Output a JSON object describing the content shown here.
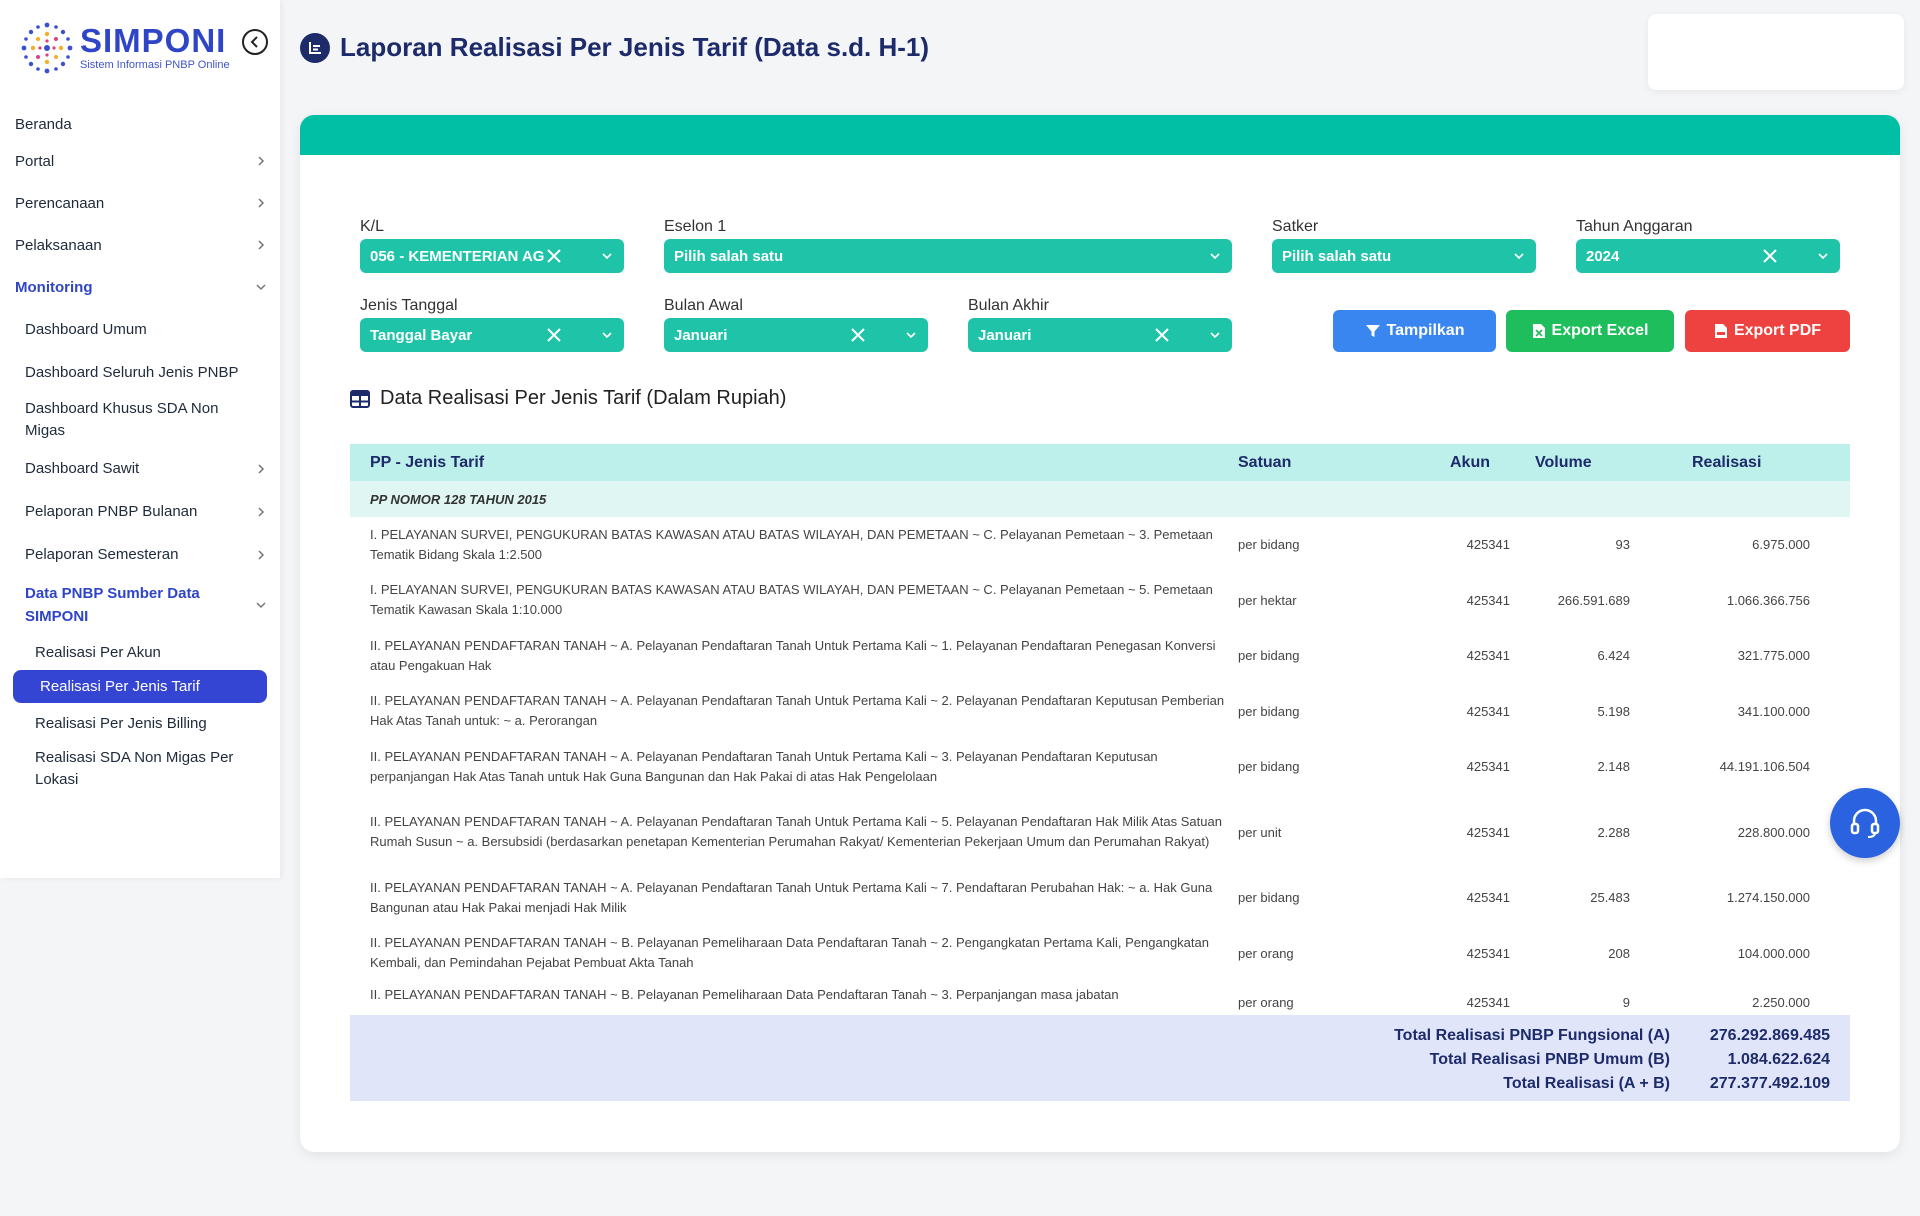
{
  "app": {
    "title": "SIMPONI",
    "subtitle": "Sistem Informasi PNBP Online"
  },
  "sidebar": {
    "items": [
      {
        "label": "Beranda"
      },
      {
        "label": "Portal"
      },
      {
        "label": "Perencanaan"
      },
      {
        "label": "Pelaksanaan"
      },
      {
        "label": "Monitoring"
      },
      {
        "label": "Dashboard Umum"
      },
      {
        "label": "Dashboard Seluruh Jenis PNBP"
      },
      {
        "label": "Dashboard Khusus SDA Non Migas"
      },
      {
        "label": "Dashboard Sawit"
      },
      {
        "label": "Pelaporan PNBP Bulanan"
      },
      {
        "label": "Pelaporan Semesteran"
      },
      {
        "label": "Data PNBP Sumber Data SIMPONI"
      },
      {
        "label": "Realisasi Per Akun"
      },
      {
        "label": "Realisasi Per Jenis Tarif"
      },
      {
        "label": "Realisasi Per Jenis Billing"
      },
      {
        "label": "Realisasi SDA Non Migas Per Lokasi"
      }
    ]
  },
  "header": {
    "title": "Laporan Realisasi Per Jenis Tarif (Data s.d. H-1)"
  },
  "filters": {
    "kl": {
      "label": "K/L",
      "value": "056 - KEMENTERIAN AG"
    },
    "eselon": {
      "label": "Eselon 1",
      "value": "Pilih salah satu"
    },
    "satker": {
      "label": "Satker",
      "value": "Pilih salah satu"
    },
    "tahun": {
      "label": "Tahun Anggaran",
      "value": "2024"
    },
    "jenis_tanggal": {
      "label": "Jenis Tanggal",
      "value": "Tanggal Bayar"
    },
    "bulan_awal": {
      "label": "Bulan Awal",
      "value": "Januari"
    },
    "bulan_akhir": {
      "label": "Bulan Akhir",
      "value": "Januari"
    }
  },
  "buttons": {
    "show": "Tampilkan",
    "excel": "Export Excel",
    "pdf": "Export PDF"
  },
  "colors": {
    "teal": "#00bfa5",
    "navy": "#1d2b6b",
    "blue": "#3a86f0",
    "green": "#1fbe5c",
    "red": "#ee4240"
  },
  "section": {
    "title": "Data Realisasi Per Jenis Tarif (Dalam Rupiah)"
  },
  "table": {
    "headers": {
      "jenis": "PP - Jenis Tarif",
      "satuan": "Satuan",
      "akun": "Akun",
      "volume": "Volume",
      "realisasi": "Realisasi"
    },
    "group": "PP NOMOR 128 TAHUN 2015",
    "rows": [
      {
        "jenis": "I. PELAYANAN SURVEI, PENGUKURAN BATAS KAWASAN ATAU BATAS WILAYAH, DAN PEMETAAN ~ C. Pelayanan Pemetaan ~ 3. Pemetaan Tematik Bidang Skala 1:2.500",
        "satuan": "per bidang",
        "akun": "425341",
        "volume": "93",
        "realisasi": "6.975.000"
      },
      {
        "jenis": "I. PELAYANAN SURVEI, PENGUKURAN BATAS KAWASAN ATAU BATAS WILAYAH, DAN PEMETAAN ~ C. Pelayanan Pemetaan ~ 5. Pemetaan Tematik Kawasan Skala 1:10.000",
        "satuan": "per hektar",
        "akun": "425341",
        "volume": "266.591.689",
        "realisasi": "1.066.366.756"
      },
      {
        "jenis": "II. PELAYANAN PENDAFTARAN TANAH ~ A. Pelayanan Pendaftaran Tanah Untuk Pertama Kali ~ 1. Pelayanan Pendaftaran Penegasan Konversi atau Pengakuan Hak",
        "satuan": "per bidang",
        "akun": "425341",
        "volume": "6.424",
        "realisasi": "321.775.000"
      },
      {
        "jenis": "II. PELAYANAN PENDAFTARAN TANAH ~ A. Pelayanan Pendaftaran Tanah Untuk Pertama Kali ~ 2. Pelayanan Pendaftaran Keputusan Pemberian Hak Atas Tanah untuk: ~ a. Perorangan",
        "satuan": "per bidang",
        "akun": "425341",
        "volume": "5.198",
        "realisasi": "341.100.000"
      },
      {
        "jenis": "II. PELAYANAN PENDAFTARAN TANAH ~ A. Pelayanan Pendaftaran Tanah Untuk Pertama Kali ~ 3. Pelayanan Pendaftaran Keputusan perpanjangan Hak Atas Tanah untuk Hak Guna Bangunan dan Hak Pakai di atas Hak Pengelolaan",
        "satuan": "per bidang",
        "akun": "425341",
        "volume": "2.148",
        "realisasi": "44.191.106.504"
      },
      {
        "jenis": "II. PELAYANAN PENDAFTARAN TANAH ~ A. Pelayanan Pendaftaran Tanah Untuk Pertama Kali ~ 5. Pelayanan Pendaftaran Hak Milik Atas Satuan Rumah Susun ~ a. Bersubsidi (berdasarkan penetapan Kementerian Perumahan Rakyat/ Kementerian Pekerjaan Umum dan Perumahan Rakyat)",
        "satuan": "per unit",
        "akun": "425341",
        "volume": "2.288",
        "realisasi": "228.800.000"
      },
      {
        "jenis": "II. PELAYANAN PENDAFTARAN TANAH ~ A. Pelayanan Pendaftaran Tanah Untuk Pertama Kali ~ 7. Pendaftaran Perubahan Hak: ~ a. Hak Guna Bangunan atau Hak Pakai menjadi Hak Milik",
        "satuan": "per bidang",
        "akun": "425341",
        "volume": "25.483",
        "realisasi": "1.274.150.000"
      },
      {
        "jenis": "II. PELAYANAN PENDAFTARAN TANAH ~ B. Pelayanan Pemeliharaan Data Pendaftaran Tanah ~ 2. Pengangkatan Pertama Kali, Pengangkatan Kembali, dan Pemindahan Pejabat Pembuat Akta Tanah",
        "satuan": "per orang",
        "akun": "425341",
        "volume": "208",
        "realisasi": "104.000.000"
      },
      {
        "jenis": "II. PELAYANAN PENDAFTARAN TANAH ~ B. Pelayanan Pemeliharaan Data Pendaftaran Tanah ~ 3. Perpanjangan masa jabatan",
        "satuan": "per orang",
        "akun": "425341",
        "volume": "9",
        "realisasi": "2.250.000"
      }
    ],
    "totals": [
      {
        "label": "Total Realisasi PNBP Fungsional (A)",
        "value": "276.292.869.485"
      },
      {
        "label": "Total Realisasi PNBP Umum (B)",
        "value": "1.084.622.624"
      },
      {
        "label": "Total Realisasi (A + B)",
        "value": "277.377.492.109"
      }
    ]
  }
}
